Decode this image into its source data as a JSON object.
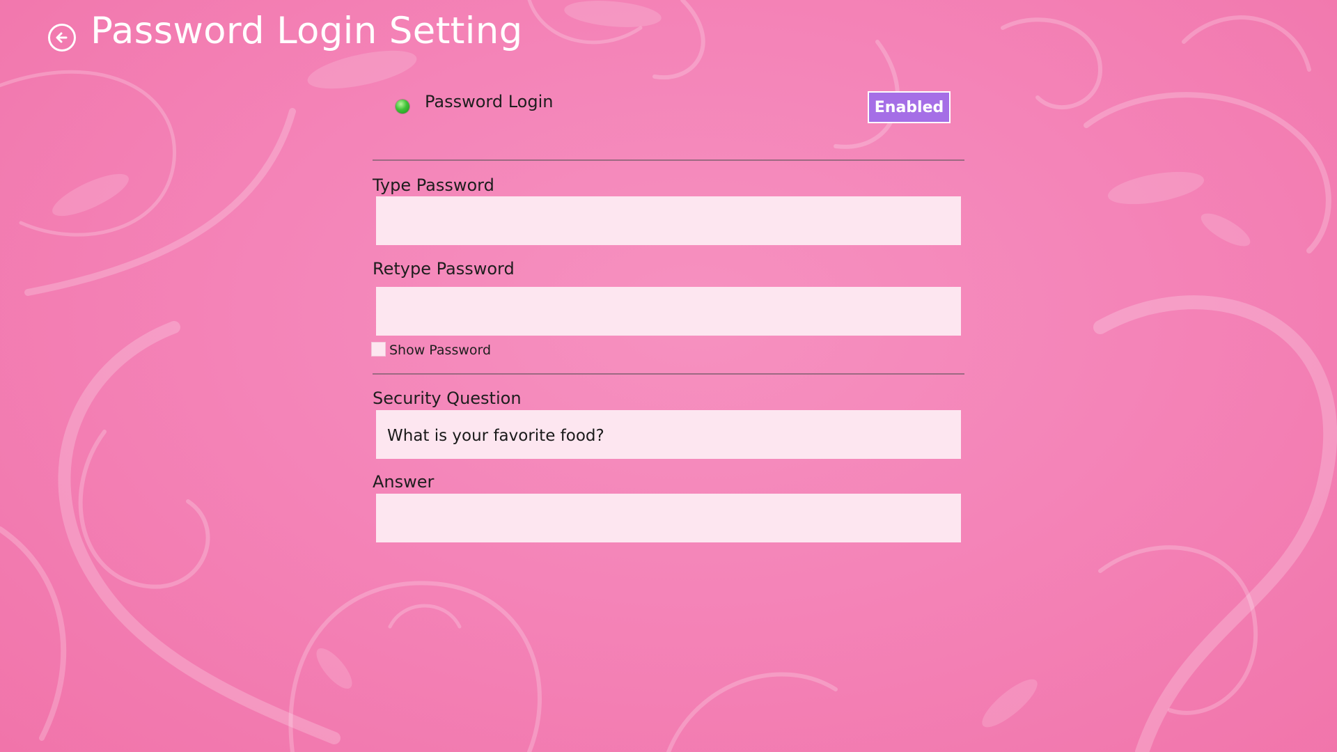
{
  "header": {
    "title": "Password Login Setting",
    "back_icon": "arrow-left-circle-icon"
  },
  "password_login": {
    "label": "Password Login",
    "status_color": "#3fc238",
    "toggle_label": "Enabled",
    "toggle_color": "#a56ee6"
  },
  "form": {
    "type_password": {
      "label": "Type Password",
      "value": ""
    },
    "retype_password": {
      "label": "Retype Password",
      "value": ""
    },
    "show_password": {
      "label": "Show Password",
      "checked": false
    },
    "security_question": {
      "label": "Security Question",
      "value": "What is your favorite food?"
    },
    "answer": {
      "label": "Answer",
      "value": ""
    }
  },
  "theme": {
    "background": "#f484b8",
    "field_background": "#fde6f0"
  }
}
